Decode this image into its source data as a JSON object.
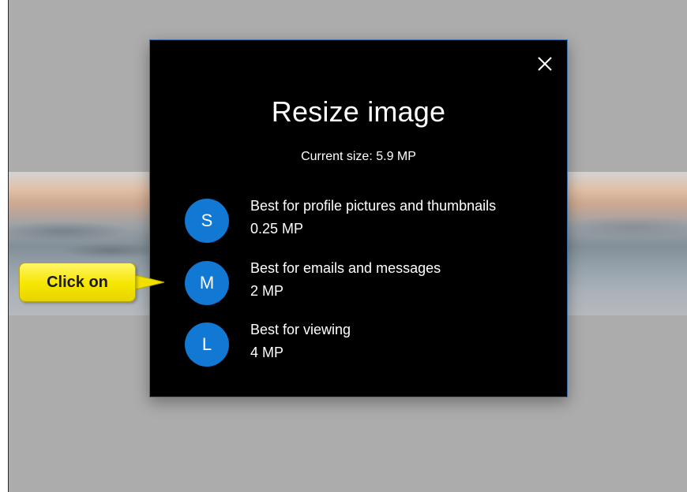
{
  "dialog": {
    "title": "Resize image",
    "current_size": "Current size: 5.9 MP",
    "close_glyph": "✕",
    "options": [
      {
        "letter": "S",
        "description": "Best for profile pictures and thumbnails",
        "size": "0.25 MP"
      },
      {
        "letter": "M",
        "description": "Best for emails and messages",
        "size": "2 MP"
      },
      {
        "letter": "L",
        "description": "Best for viewing",
        "size": "4 MP"
      }
    ]
  },
  "callout": {
    "text": "Click on"
  },
  "colors": {
    "accent": "#1178d4",
    "dialog_bg": "#000000",
    "overlay": "#acacac",
    "callout": "#f6e600"
  }
}
